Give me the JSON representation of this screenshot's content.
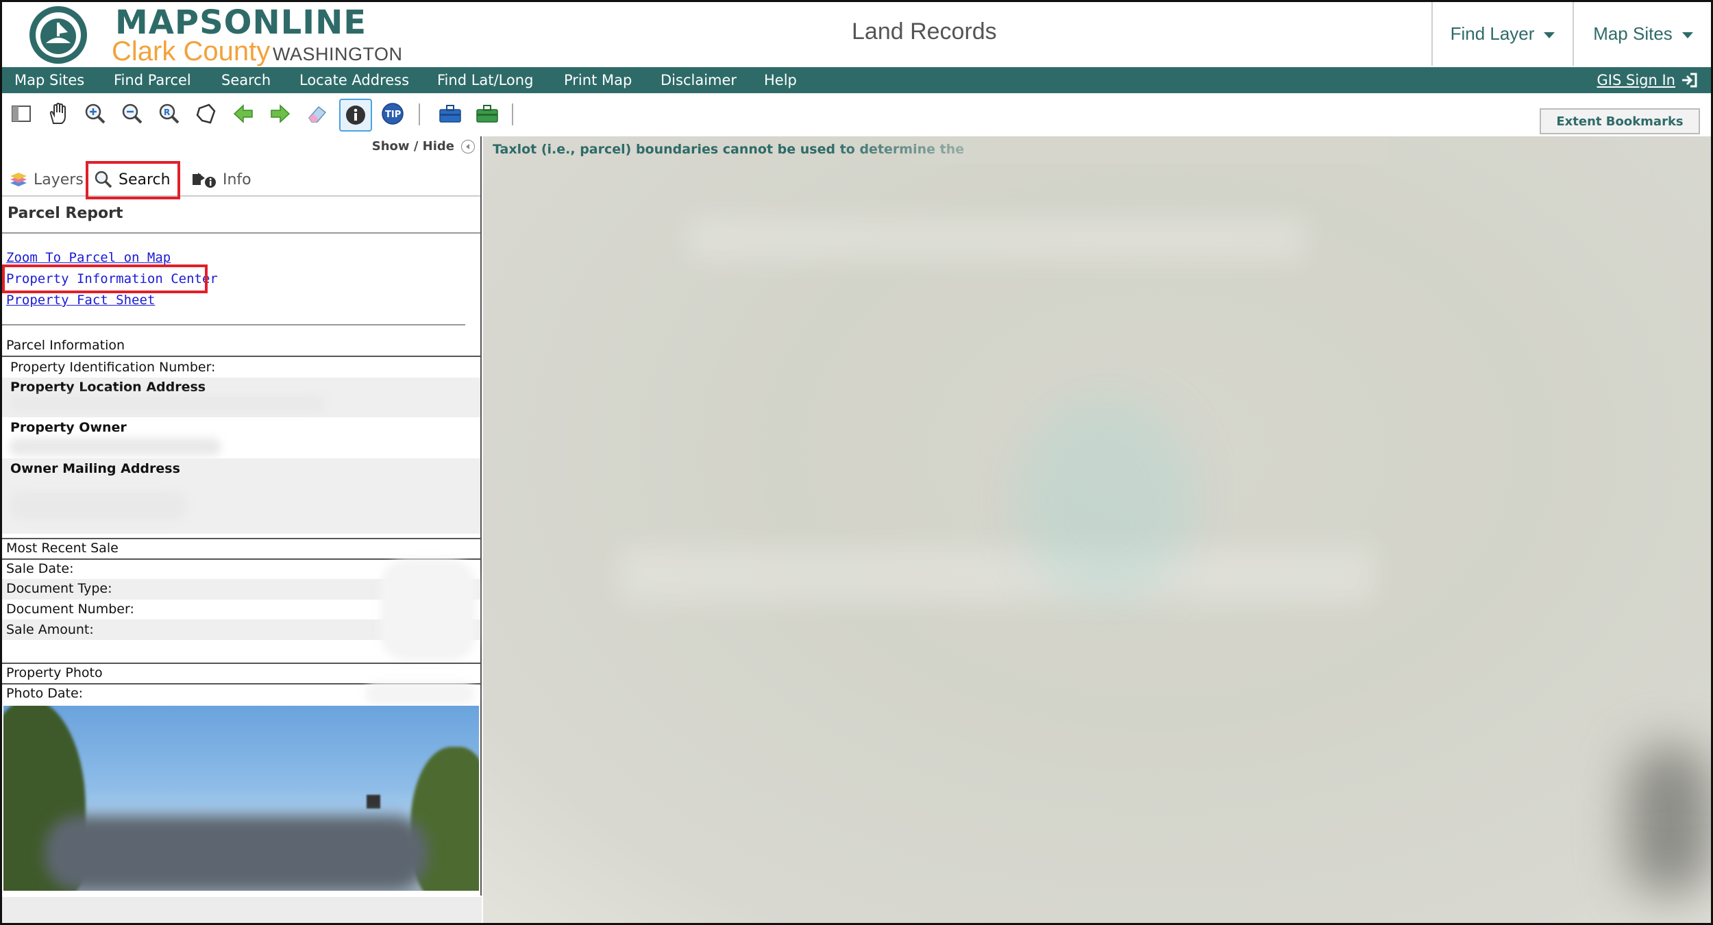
{
  "header": {
    "brand_line1": "MAPSONLINE",
    "brand_line2": "Clark County",
    "brand_line3": "WASHINGTON",
    "seal_text": "CLARK COUNTY WASHINGTON",
    "app_title": "Land Records",
    "find_layer": "Find Layer",
    "map_sites": "Map Sites"
  },
  "nav": {
    "items": [
      "Map Sites",
      "Find Parcel",
      "Search",
      "Locate Address",
      "Find Lat/Long",
      "Print Map",
      "Disclaimer",
      "Help"
    ],
    "sign_in": "GIS Sign In"
  },
  "toolbar": {
    "tools": [
      "panel-toggle-icon",
      "pan-hand-icon",
      "zoom-in-icon",
      "zoom-out-icon",
      "zoom-extent-icon",
      "select-polygon-icon",
      "back-arrow-icon",
      "forward-arrow-icon",
      "eraser-icon",
      "identify-info-icon",
      "tip-icon",
      "toolbox-blue-icon",
      "toolbox-green-icon"
    ],
    "extent_bookmarks": "Extent Bookmarks"
  },
  "panel": {
    "show_hide": "Show / Hide",
    "tabs": [
      "Layers",
      "Search",
      "Info"
    ],
    "parcel_report_title": "Parcel Report",
    "links": [
      "Zoom To Parcel on Map",
      "Property Information Center",
      "Property Fact Sheet"
    ],
    "parcel_info": {
      "section": "Parcel Information",
      "pin_label": "Property Identification Number:",
      "location_label": "Property Location Address",
      "owner_label": "Property Owner",
      "mailing_label": "Owner Mailing Address"
    },
    "recent_sale": {
      "section": "Most Recent Sale",
      "fields": [
        "Sale Date:",
        "Document Type:",
        "Document Number:",
        "Sale Amount:"
      ]
    },
    "photo": {
      "section": "Property Photo",
      "date_label": "Photo Date:"
    }
  },
  "map": {
    "notice": "Taxlot (i.e., parcel) boundaries cannot be used to determine the"
  },
  "colors": {
    "brand_teal": "#2e6b68",
    "brand_orange": "#f2a23b",
    "link_blue": "#1a1ad6",
    "highlight_red": "#e0202a"
  }
}
